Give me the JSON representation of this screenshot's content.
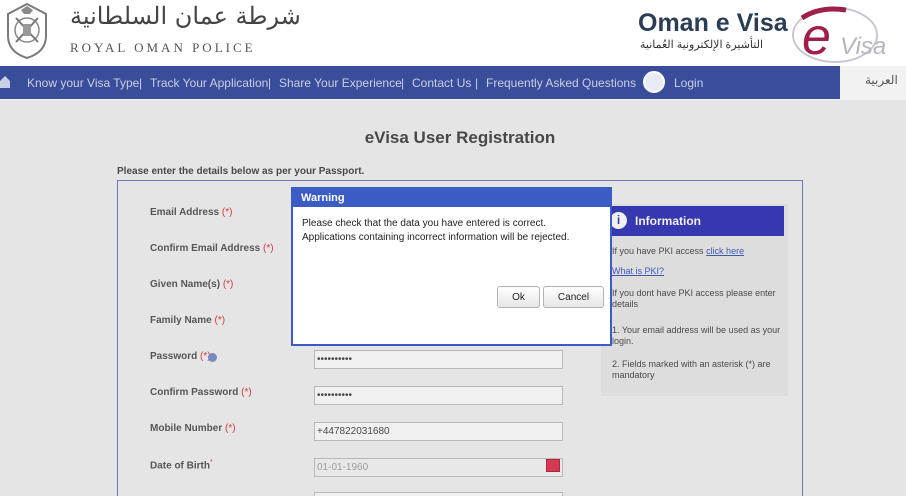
{
  "header": {
    "rop_arabic": "شرطة عمان السلطانية",
    "rop_english": "ROYAL OMAN POLICE",
    "evisa_title": "Oman e Visa",
    "evisa_arabic": "التأشيرة الإلكترونية العُمانية",
    "evisa_logo_text": "eVisa"
  },
  "nav": {
    "items": [
      "Know your Visa Type",
      "Track Your Application",
      "Share Your Experience",
      "Contact Us",
      "Frequently Asked Questions",
      "Login"
    ],
    "separator": "|",
    "language_link": "العربية",
    "bar_color": "#3a4d9b"
  },
  "page": {
    "title": "eVisa User Registration",
    "passport_note": "Please enter the details below as per your Passport."
  },
  "form": {
    "required_mark": "(*)",
    "email_label": "Email Address",
    "confirm_email_label": "Confirm Email Address",
    "given_name_label": "Given Name(s)",
    "family_name_label": "Family Name",
    "password_label": "Password",
    "password_value": "••••••••••",
    "confirm_password_label": "Confirm Password",
    "confirm_password_value": "••••••••••",
    "mobile_label": "Mobile Number",
    "mobile_value": "+447822031680",
    "dob_label": "Date of Birth",
    "dob_mark": "*",
    "dob_value": "01-01-1960"
  },
  "info": {
    "title": "Information",
    "pki_prefix": "If you have PKI access ",
    "pki_link": "click here",
    "what_is_pki": "What is PKI?",
    "no_pki": "If you dont have PKI access please enter details",
    "note1": "1. Your email address will be used as your login.",
    "note2": "2. Fields marked with an asterisk (*) are mandatory",
    "header_color": "#1e1eb0"
  },
  "dialog": {
    "title": "Warning",
    "line1": "Please check that the data you have entered is correct.",
    "line2": "Applications containing incorrect information will be rejected.",
    "ok_label": "Ok",
    "cancel_label": "Cancel",
    "accent_color": "#3a5cc4"
  }
}
